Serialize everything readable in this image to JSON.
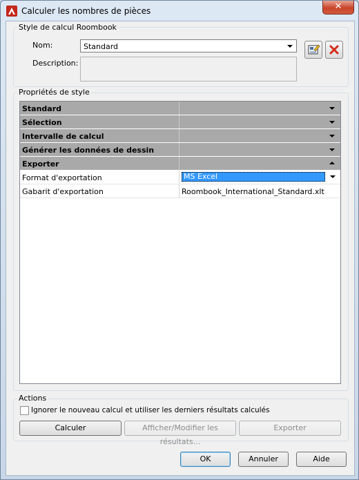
{
  "window": {
    "title": "Calculer les nombres de pièces",
    "close_symbol": "✕"
  },
  "style_group": {
    "label": "Style de calcul Roombook",
    "name_label": "Nom:",
    "name_value": "Standard",
    "description_label": "Description:",
    "description_value": ""
  },
  "properties": {
    "label": "Propriétés de style",
    "categories": [
      {
        "label": "Standard",
        "expanded": false
      },
      {
        "label": "Sélection",
        "expanded": false
      },
      {
        "label": "Intervalle de calcul",
        "expanded": false
      },
      {
        "label": "Générer les données de dessin",
        "expanded": false
      },
      {
        "label": "Exporter",
        "expanded": true
      }
    ],
    "rows": [
      {
        "name": "Format d'exportation",
        "value": "MS Excel"
      },
      {
        "name": "Gabarit d'exportation",
        "value": "Roombook_International_Standard.xlt"
      }
    ]
  },
  "actions": {
    "label": "Actions",
    "checkbox_label": "Ignorer le nouveau calcul et utiliser les derniers résultats calculés",
    "checkbox_checked": false,
    "calculate": "Calculer",
    "show_results": "Afficher/Modifier les résultats...",
    "export": "Exporter"
  },
  "footer": {
    "ok": "OK",
    "cancel": "Annuler",
    "help": "Aide"
  }
}
